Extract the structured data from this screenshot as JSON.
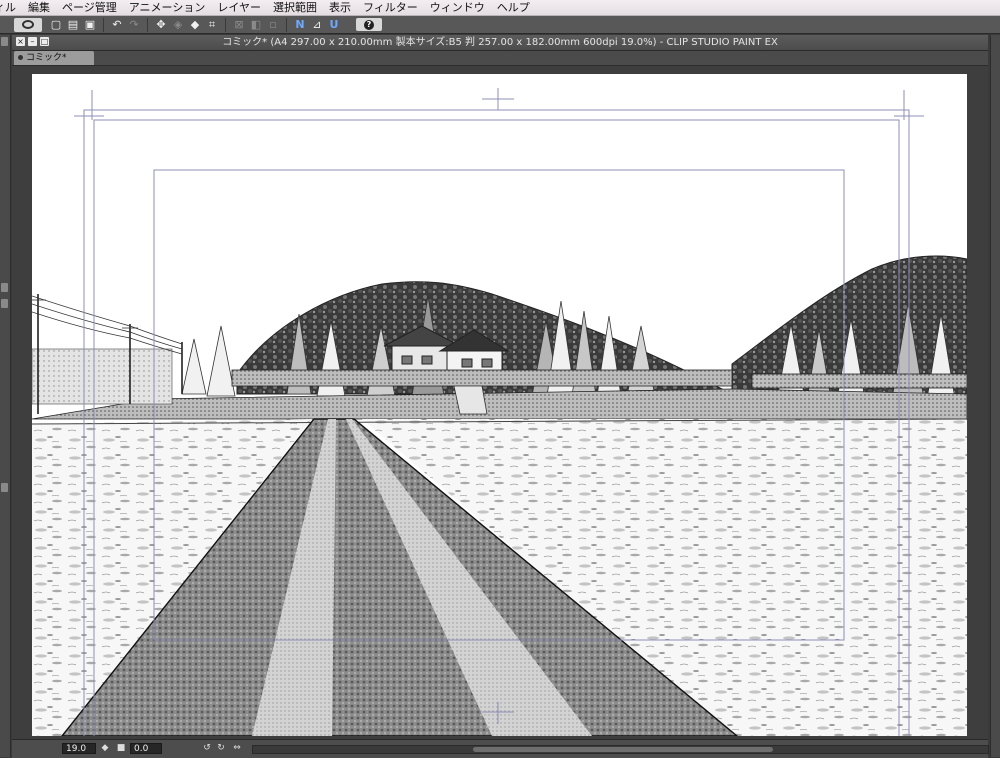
{
  "menubar": {
    "items": [
      "ィル",
      "編集",
      "ページ管理",
      "アニメーション",
      "レイヤー",
      "選択範囲",
      "表示",
      "フィルター",
      "ウィンドウ",
      "ヘルプ"
    ]
  },
  "toolbar": {
    "buttons": [
      {
        "name": "new-file-icon",
        "glyph": "▢"
      },
      {
        "name": "open-file-icon",
        "glyph": "▤"
      },
      {
        "name": "save-icon",
        "glyph": "▣"
      },
      {
        "name": "undo-icon",
        "glyph": "↶"
      },
      {
        "name": "redo-icon",
        "glyph": "↷"
      },
      {
        "name": "move-icon",
        "glyph": "✥"
      },
      {
        "name": "transform-icon",
        "glyph": "◈"
      },
      {
        "name": "fill-icon",
        "glyph": "◆"
      },
      {
        "name": "scale-icon",
        "glyph": "⌗"
      },
      {
        "name": "clear-selection-icon",
        "glyph": "⊠"
      },
      {
        "name": "invert-selection-icon",
        "glyph": "◧"
      },
      {
        "name": "show-selection-icon",
        "glyph": "▫"
      },
      {
        "name": "ruler-snap-icon",
        "glyph": "N"
      },
      {
        "name": "special-ruler-snap-icon",
        "glyph": "⊿"
      },
      {
        "name": "grid-snap-icon",
        "glyph": "U"
      }
    ],
    "help_icon": "?"
  },
  "document": {
    "title": "コミック* (A4 297.00 x 210.00mm 製本サイズ:B5 判 257.00 x 182.00mm 600dpi 19.0%)  - CLIP STUDIO PAINT EX",
    "tab_label": "コミック*"
  },
  "statusbar": {
    "zoom": "19.0",
    "rotation": "0.0"
  },
  "colors": {
    "menubar": "#ece6ea",
    "ui_dark": "#4d4d4d",
    "canvas_bg": "#3e3e3e",
    "paper": "#ffffff",
    "guide_frame": "#8f8fb8"
  }
}
